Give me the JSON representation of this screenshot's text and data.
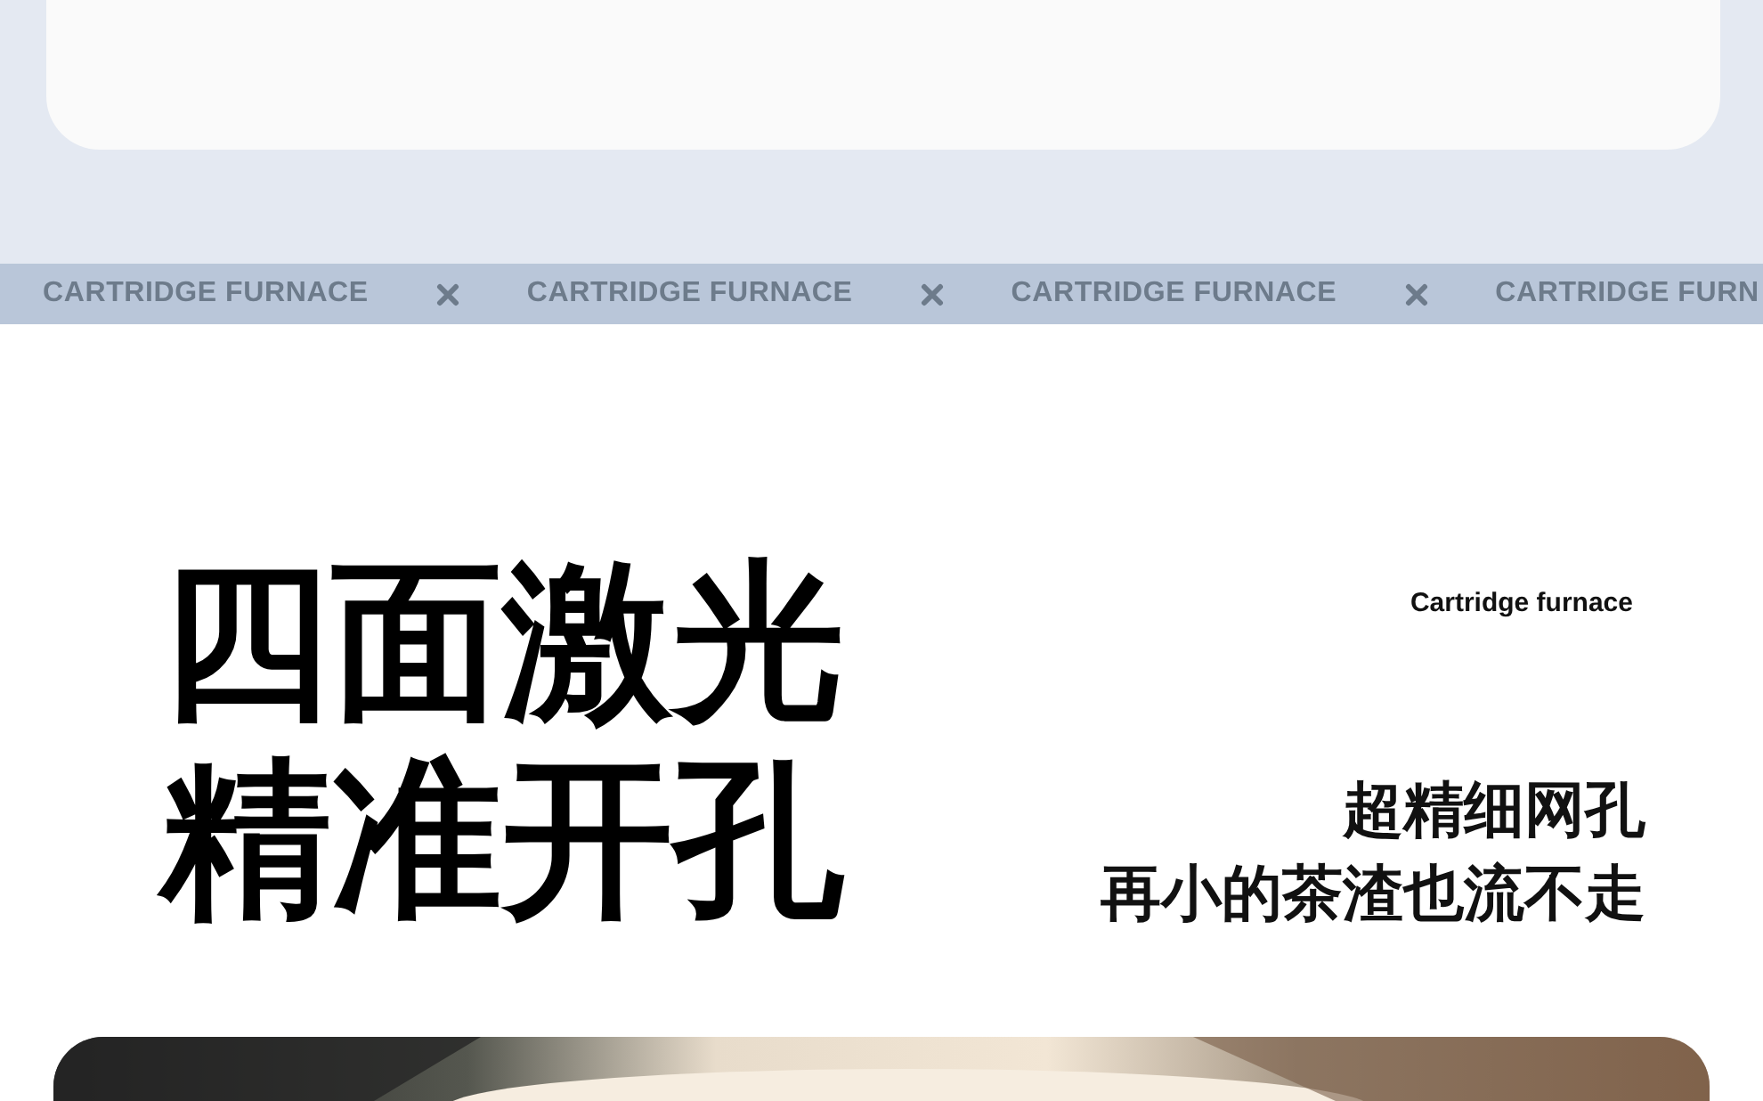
{
  "band": {
    "items": [
      {
        "kind": "text",
        "text": "CARTRIDGE FURNACE"
      },
      {
        "kind": "icon"
      },
      {
        "kind": "text",
        "text": "CARTRIDGE FURNACE"
      },
      {
        "kind": "icon"
      },
      {
        "kind": "text",
        "text": "CARTRIDGE FURNACE"
      },
      {
        "kind": "icon"
      },
      {
        "kind": "text",
        "text": "CARTRIDGE FURN"
      }
    ]
  },
  "headline": [
    "四面激光",
    "精准开孔"
  ],
  "subtitle": "Cartridge furnace",
  "tagline": [
    "超精细网孔",
    "再小的茶渣也流不走"
  ]
}
